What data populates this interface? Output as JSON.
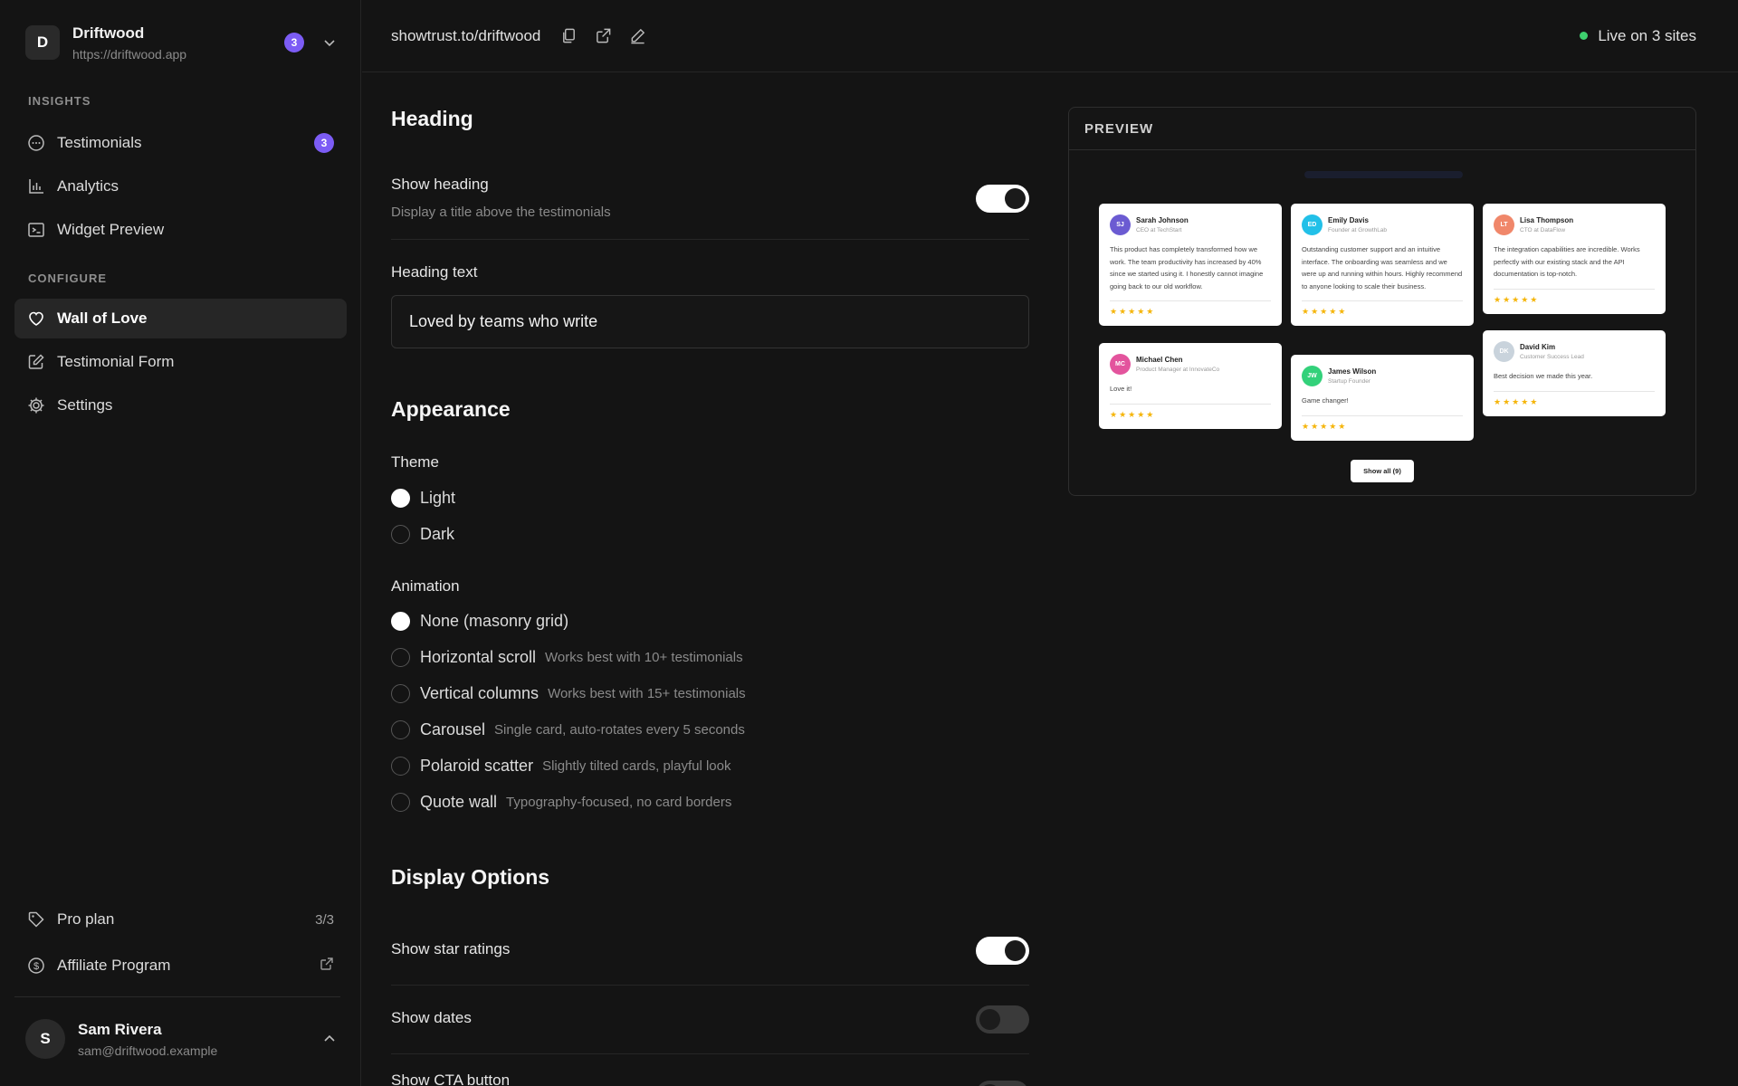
{
  "workspace": {
    "initial": "D",
    "name": "Driftwood",
    "url": "https://driftwood.app",
    "badge": "3"
  },
  "sidebar": {
    "insights_label": "INSIGHTS",
    "configure_label": "CONFIGURE",
    "insights": [
      {
        "label": "Testimonials",
        "icon": "message-circle-icon",
        "badge": "3"
      },
      {
        "label": "Analytics",
        "icon": "bar-chart-icon"
      },
      {
        "label": "Widget Preview",
        "icon": "terminal-icon"
      }
    ],
    "configure": [
      {
        "label": "Wall of Love",
        "icon": "heart-icon"
      },
      {
        "label": "Testimonial Form",
        "icon": "edit-icon"
      },
      {
        "label": "Settings",
        "icon": "gear-icon"
      }
    ],
    "plan": {
      "label": "Pro plan",
      "value": "3/3",
      "icon": "tag-icon"
    },
    "affiliate": {
      "label": "Affiliate Program",
      "icon": "dollar-icon"
    }
  },
  "user": {
    "initial": "S",
    "name": "Sam Rivera",
    "email": "sam@driftwood.example"
  },
  "topbar": {
    "url": "showtrust.to/driftwood",
    "status": "Live on 3 sites"
  },
  "heading_section": {
    "title": "Heading",
    "show_heading": {
      "label": "Show heading",
      "description": "Display a title above the testimonials",
      "enabled": true
    },
    "heading_text_label": "Heading text",
    "heading_text_value": "Loved by teams who write"
  },
  "appearance": {
    "title": "Appearance",
    "theme_label": "Theme",
    "themes": [
      {
        "label": "Light",
        "checked": true
      },
      {
        "label": "Dark",
        "checked": false
      }
    ],
    "animation_label": "Animation",
    "animations": [
      {
        "label": "None (masonry grid)",
        "hint": "",
        "checked": true
      },
      {
        "label": "Horizontal scroll",
        "hint": "Works best with 10+ testimonials",
        "checked": false
      },
      {
        "label": "Vertical columns",
        "hint": "Works best with 15+ testimonials",
        "checked": false
      },
      {
        "label": "Carousel",
        "hint": "Single card, auto-rotates every 5 seconds",
        "checked": false
      },
      {
        "label": "Polaroid scatter",
        "hint": "Slightly tilted cards, playful look",
        "checked": false
      },
      {
        "label": "Quote wall",
        "hint": "Typography-focused, no card borders",
        "checked": false
      }
    ]
  },
  "display_options": {
    "title": "Display Options",
    "items": [
      {
        "label": "Show star ratings",
        "enabled": true
      },
      {
        "label": "Show dates",
        "enabled": false
      },
      {
        "label": "Show CTA button",
        "enabled": false
      }
    ]
  },
  "preview": {
    "label": "PREVIEW",
    "show_all": "Show all (9)",
    "cards": [
      {
        "initials": "SJ",
        "color": "#6b5bd2",
        "name": "Sarah Johnson",
        "role": "CEO at TechStart",
        "text": "This product has completely transformed how we work. The team productivity has increased by 40% since we started using it. I honestly cannot imagine going back to our old workflow.",
        "stars": "★★★★★"
      },
      {
        "initials": "MC",
        "color": "#e3549d",
        "name": "Michael Chen",
        "role": "Product Manager at InnovateCo",
        "text": "Love it!",
        "stars": "★★★★★"
      },
      {
        "initials": "ED",
        "color": "#22c0e8",
        "name": "Emily Davis",
        "role": "Founder at GrowthLab",
        "text": "Outstanding customer support and an intuitive interface. The onboarding was seamless and we were up and running within hours. Highly recommend to anyone looking to scale their business.",
        "stars": "★★★★★"
      },
      {
        "initials": "JW",
        "color": "#33d17a",
        "name": "James Wilson",
        "role": "Startup Founder",
        "text": "Game changer!",
        "stars": "★★★★★"
      },
      {
        "initials": "LT",
        "color": "#f0876a",
        "name": "Lisa Thompson",
        "role": "CTO at DataFlow",
        "text": "The integration capabilities are incredible. Works perfectly with our existing stack and the API documentation is top-notch.",
        "stars": "★★★★★"
      },
      {
        "initials": "DK",
        "color": "#c9d3dc",
        "name": "David Kim",
        "role": "Customer Success Lead",
        "text": "Best decision we made this year.",
        "stars": "★★★★★"
      }
    ]
  }
}
